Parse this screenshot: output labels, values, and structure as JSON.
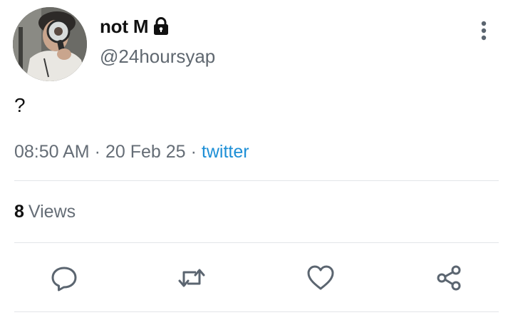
{
  "author": {
    "display_name": "not M",
    "handle": "@24hoursyap",
    "protected": true
  },
  "tweet": {
    "text": "?",
    "time": "08:50 AM",
    "date": "20 Feb 25",
    "separator": "·",
    "source": "twitter"
  },
  "stats": {
    "views_count": "8",
    "views_label": "Views"
  },
  "actions": [
    {
      "name": "reply",
      "icon": "reply-icon"
    },
    {
      "name": "retweet",
      "icon": "retweet-icon"
    },
    {
      "name": "like",
      "icon": "heart-icon"
    },
    {
      "name": "share",
      "icon": "share-icon"
    }
  ],
  "colors": {
    "text": "#111111",
    "secondary": "#656d76",
    "link": "#1d8fd6",
    "divider": "#e3e5e8",
    "icon": "#5b6570"
  }
}
